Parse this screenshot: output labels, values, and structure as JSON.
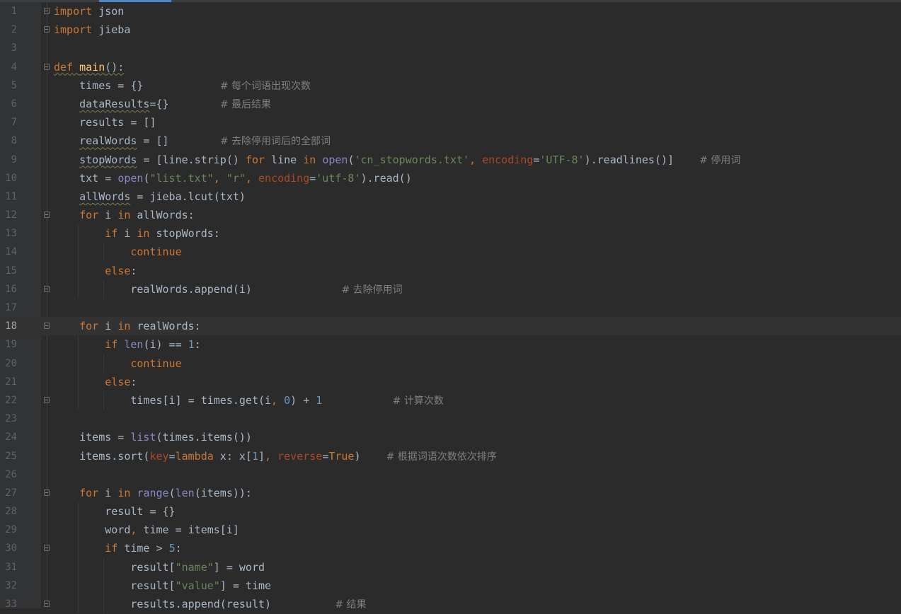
{
  "colors": {
    "background": "#2b2b2b",
    "gutter": "#313335",
    "keyword": "#cc7832",
    "string": "#6a8759",
    "number": "#6897bb",
    "function": "#ffc66d",
    "builtin": "#8888c6",
    "comment": "#808080",
    "parameter": "#aa4926",
    "text": "#a9b7c6"
  },
  "editor": {
    "current_line": 18,
    "lines": [
      {
        "n": "1",
        "fold": true,
        "indent": 0,
        "tokens": [
          [
            "kw",
            "import"
          ],
          [
            "t",
            " json"
          ]
        ]
      },
      {
        "n": "2",
        "fold": true,
        "indent": 0,
        "tokens": [
          [
            "kw",
            "import"
          ],
          [
            "t",
            " jieba"
          ]
        ]
      },
      {
        "n": "3",
        "indent": 0,
        "tokens": []
      },
      {
        "n": "4",
        "fold": true,
        "indent": 0,
        "tokens": [
          [
            "kw ul",
            "def"
          ],
          [
            "t ul",
            " "
          ],
          [
            "fn ul",
            "main"
          ],
          [
            "t ul",
            "():"
          ]
        ]
      },
      {
        "n": "5",
        "indent": 1,
        "tokens": [
          [
            "t",
            "    times = {}            "
          ],
          [
            "cm",
            "# 每个词语出现次数"
          ]
        ]
      },
      {
        "n": "6",
        "indent": 1,
        "tokens": [
          [
            "t",
            "    "
          ],
          [
            "t ul",
            "dataResults"
          ],
          [
            "t",
            "={}        "
          ],
          [
            "cm",
            "# 最后结果"
          ]
        ]
      },
      {
        "n": "7",
        "indent": 1,
        "tokens": [
          [
            "t",
            "    results = []"
          ]
        ]
      },
      {
        "n": "8",
        "indent": 1,
        "tokens": [
          [
            "t",
            "    "
          ],
          [
            "t ul",
            "realWords"
          ],
          [
            "t",
            " = []        "
          ],
          [
            "cm",
            "# 去除停用词后的全部词"
          ]
        ]
      },
      {
        "n": "9",
        "indent": 1,
        "tokens": [
          [
            "t",
            "    "
          ],
          [
            "t ul",
            "stopWords"
          ],
          [
            "t",
            " = [line.strip() "
          ],
          [
            "kw",
            "for"
          ],
          [
            "t",
            " line "
          ],
          [
            "kw",
            "in"
          ],
          [
            "t",
            " "
          ],
          [
            "bi",
            "open"
          ],
          [
            "t",
            "("
          ],
          [
            "str",
            "'cn_stopwords.txt'"
          ],
          [
            "kw",
            ","
          ],
          [
            "t",
            " "
          ],
          [
            "par",
            "encoding"
          ],
          [
            "t",
            "="
          ],
          [
            "str",
            "'UTF-8'"
          ],
          [
            "t",
            ").readlines()]    "
          ],
          [
            "cm",
            "# 停用词"
          ]
        ]
      },
      {
        "n": "10",
        "indent": 1,
        "tokens": [
          [
            "t",
            "    txt = "
          ],
          [
            "bi",
            "open"
          ],
          [
            "t",
            "("
          ],
          [
            "str",
            "\"list.txt\""
          ],
          [
            "kw",
            ","
          ],
          [
            "t",
            " "
          ],
          [
            "str",
            "\"r\""
          ],
          [
            "kw",
            ","
          ],
          [
            "t",
            " "
          ],
          [
            "par",
            "encoding"
          ],
          [
            "t",
            "="
          ],
          [
            "str",
            "'utf-8'"
          ],
          [
            "t",
            ").read()"
          ]
        ]
      },
      {
        "n": "11",
        "indent": 1,
        "tokens": [
          [
            "t",
            "    "
          ],
          [
            "t ul",
            "allWords"
          ],
          [
            "t",
            " = jieba.lcut(txt)"
          ]
        ]
      },
      {
        "n": "12",
        "fold": true,
        "indent": 1,
        "tokens": [
          [
            "t",
            "    "
          ],
          [
            "kw",
            "for"
          ],
          [
            "t",
            " i "
          ],
          [
            "kw",
            "in"
          ],
          [
            "t",
            " allWords:"
          ]
        ]
      },
      {
        "n": "13",
        "fold": false,
        "indent": 2,
        "tokens": [
          [
            "t",
            "        "
          ],
          [
            "kw",
            "if"
          ],
          [
            "t",
            " i "
          ],
          [
            "kw",
            "in"
          ],
          [
            "t",
            " stopWords:"
          ]
        ]
      },
      {
        "n": "14",
        "indent": 3,
        "tokens": [
          [
            "t",
            "            "
          ],
          [
            "kw",
            "continue"
          ]
        ]
      },
      {
        "n": "15",
        "indent": 2,
        "tokens": [
          [
            "t",
            "        "
          ],
          [
            "kw",
            "else"
          ],
          [
            "t",
            ":"
          ]
        ]
      },
      {
        "n": "16",
        "fold": true,
        "indent": 3,
        "tokens": [
          [
            "t",
            "            realWords.append(i)              "
          ],
          [
            "cm",
            "# 去除停用词"
          ]
        ]
      },
      {
        "n": "17",
        "indent": 0,
        "tokens": []
      },
      {
        "n": "18",
        "fold": true,
        "indent": 1,
        "tokens": [
          [
            "t",
            "    "
          ],
          [
            "kw",
            "for"
          ],
          [
            "t",
            " i "
          ],
          [
            "kw",
            "in"
          ],
          [
            "t",
            " realWords:"
          ]
        ]
      },
      {
        "n": "19",
        "indent": 2,
        "tokens": [
          [
            "t",
            "        "
          ],
          [
            "kw",
            "if"
          ],
          [
            "t",
            " "
          ],
          [
            "bi",
            "len"
          ],
          [
            "t",
            "(i) == "
          ],
          [
            "num",
            "1"
          ],
          [
            "t",
            ":"
          ]
        ]
      },
      {
        "n": "20",
        "indent": 3,
        "tokens": [
          [
            "t",
            "            "
          ],
          [
            "kw",
            "continue"
          ]
        ]
      },
      {
        "n": "21",
        "indent": 2,
        "tokens": [
          [
            "t",
            "        "
          ],
          [
            "kw",
            "else"
          ],
          [
            "t",
            ":"
          ]
        ]
      },
      {
        "n": "22",
        "fold": true,
        "indent": 3,
        "tokens": [
          [
            "t",
            "            times[i] = times.get(i"
          ],
          [
            "kw",
            ","
          ],
          [
            "t",
            " "
          ],
          [
            "num",
            "0"
          ],
          [
            "t",
            ") + "
          ],
          [
            "num",
            "1"
          ],
          [
            "t",
            "           "
          ],
          [
            "cm",
            "# 计算次数"
          ]
        ]
      },
      {
        "n": "23",
        "indent": 0,
        "tokens": []
      },
      {
        "n": "24",
        "indent": 1,
        "tokens": [
          [
            "t",
            "    items = "
          ],
          [
            "bi",
            "list"
          ],
          [
            "t",
            "(times.items())"
          ]
        ]
      },
      {
        "n": "25",
        "indent": 1,
        "tokens": [
          [
            "t",
            "    items.sort("
          ],
          [
            "par",
            "key"
          ],
          [
            "t",
            "="
          ],
          [
            "kw",
            "lambda"
          ],
          [
            "t",
            " x: x["
          ],
          [
            "num",
            "1"
          ],
          [
            "t",
            "]"
          ],
          [
            "kw",
            ","
          ],
          [
            "t",
            " "
          ],
          [
            "par",
            "reverse"
          ],
          [
            "t",
            "="
          ],
          [
            "kw",
            "True"
          ],
          [
            "t",
            ")    "
          ],
          [
            "cm",
            "# 根据词语次数依次排序"
          ]
        ]
      },
      {
        "n": "26",
        "indent": 0,
        "tokens": []
      },
      {
        "n": "27",
        "fold": true,
        "indent": 1,
        "tokens": [
          [
            "t",
            "    "
          ],
          [
            "kw",
            "for"
          ],
          [
            "t",
            " i "
          ],
          [
            "kw",
            "in"
          ],
          [
            "t",
            " "
          ],
          [
            "bi",
            "range"
          ],
          [
            "t",
            "("
          ],
          [
            "bi",
            "len"
          ],
          [
            "t",
            "(items)):"
          ]
        ]
      },
      {
        "n": "28",
        "indent": 2,
        "tokens": [
          [
            "t",
            "        result = {}"
          ]
        ]
      },
      {
        "n": "29",
        "indent": 2,
        "tokens": [
          [
            "t",
            "        word"
          ],
          [
            "kw",
            ","
          ],
          [
            "t",
            " time = items[i]"
          ]
        ]
      },
      {
        "n": "30",
        "fold": true,
        "indent": 2,
        "tokens": [
          [
            "t",
            "        "
          ],
          [
            "kw",
            "if"
          ],
          [
            "t",
            " time > "
          ],
          [
            "num",
            "5"
          ],
          [
            "t",
            ":"
          ]
        ]
      },
      {
        "n": "31",
        "indent": 3,
        "tokens": [
          [
            "t",
            "            result["
          ],
          [
            "str",
            "\"name\""
          ],
          [
            "t",
            "] = word"
          ]
        ]
      },
      {
        "n": "32",
        "indent": 3,
        "tokens": [
          [
            "t",
            "            result["
          ],
          [
            "str",
            "\"value\""
          ],
          [
            "t",
            "] = time"
          ]
        ]
      },
      {
        "n": "33",
        "fold": true,
        "indent": 3,
        "tokens": [
          [
            "t",
            "            results.append(result)          "
          ],
          [
            "cm",
            "# 结果"
          ]
        ]
      }
    ]
  }
}
